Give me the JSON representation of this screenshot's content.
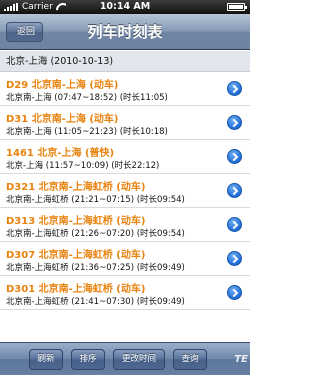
{
  "status_bar": {
    "carrier": "Carrier",
    "time": "10:14 AM"
  },
  "nav": {
    "back_label": "返回",
    "title": "列车时刻表"
  },
  "route_header": "北京-上海 (2010-10-13)",
  "trains": [
    {
      "title": "D29 北京南-上海 (动车)",
      "detail": "北京南-上海 (07:47~18:52) (时长11:05)"
    },
    {
      "title": "D31 北京南-上海 (动车)",
      "detail": "北京南-上海 (11:05~21:23) (时长10:18)"
    },
    {
      "title": "1461 北京-上海 (普快)",
      "detail": "北京-上海 (11:57~10:09) (时长22:12)"
    },
    {
      "title": "D321 北京南-上海虹桥 (动车)",
      "detail": "北京南-上海虹桥 (21:21~07:15) (时长09:54)"
    },
    {
      "title": "D313 北京南-上海虹桥 (动车)",
      "detail": "北京南-上海虹桥 (21:26~07:20) (时长09:54)"
    },
    {
      "title": "D307 北京南-上海虹桥 (动车)",
      "detail": "北京南-上海虹桥 (21:36~07:25) (时长09:49)"
    },
    {
      "title": "D301 北京南-上海虹桥 (动车)",
      "detail": "北京南-上海虹桥 (21:41~07:30) (时长09:49)"
    },
    {
      "title": "",
      "detail": ""
    }
  ],
  "toolbar": {
    "refresh": "刷新",
    "sort": "排序",
    "change_time": "更改时间",
    "query": "查询"
  },
  "watermark": "TE"
}
